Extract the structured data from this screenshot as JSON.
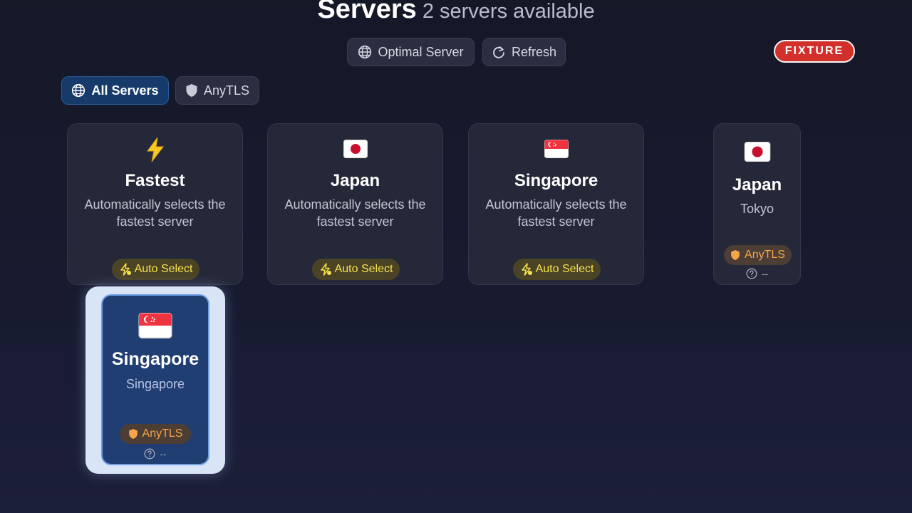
{
  "header": {
    "title": "Servers",
    "subtitle": "2 servers available"
  },
  "toolbar": {
    "optimal_label": "Optimal Server",
    "refresh_label": "Refresh"
  },
  "fixture_badge": "FIXTURE",
  "filters": [
    {
      "label": "All Servers",
      "icon": "globe-icon",
      "active": true
    },
    {
      "label": "AnyTLS",
      "icon": "shield-icon",
      "active": false
    }
  ],
  "auto_cards": [
    {
      "icon": "lightning-icon",
      "name": "Fastest",
      "desc_line1": "Automatically selects the",
      "desc_line2": "fastest server",
      "badge": "Auto Select"
    },
    {
      "icon": "japan-flag-icon",
      "name": "Japan",
      "desc_line1": "Automatically selects the",
      "desc_line2": "fastest server",
      "badge": "Auto Select"
    },
    {
      "icon": "singapore-flag-icon",
      "name": "Singapore",
      "desc_line1": "Automatically selects the",
      "desc_line2": "fastest server",
      "badge": "Auto Select"
    }
  ],
  "servers": [
    {
      "icon": "japan-flag-icon",
      "name": "Japan",
      "location": "Tokyo",
      "protocol": "AnyTLS",
      "latency": "--",
      "focused": false
    },
    {
      "icon": "singapore-flag-icon",
      "name": "Singapore",
      "location": "Singapore",
      "protocol": "AnyTLS",
      "latency": "--",
      "focused": true
    }
  ],
  "colors": {
    "background": "#161a2c",
    "card": "#252838",
    "focus_card": "#203e72",
    "accent_yellow": "#f7e24d",
    "accent_orange": "#f5a54a",
    "fixture_red": "#d2302a"
  }
}
